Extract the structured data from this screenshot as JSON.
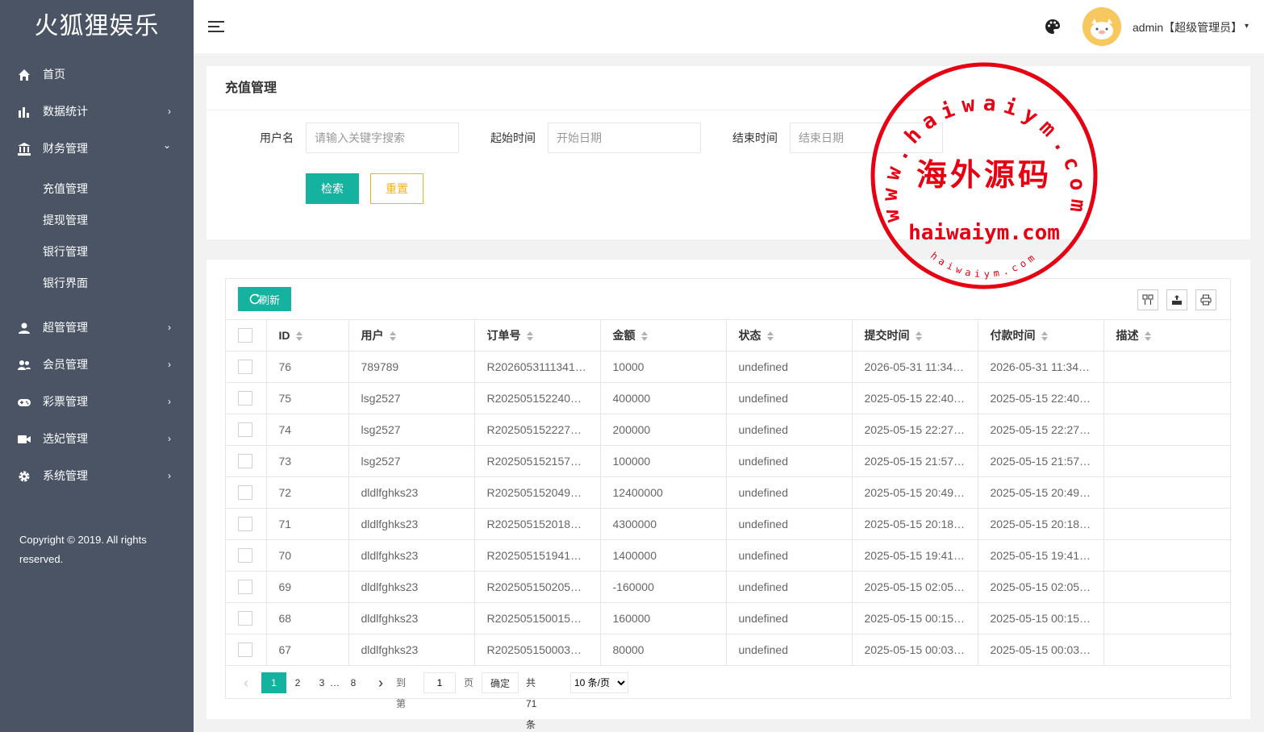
{
  "app": {
    "logo": "火狐狸娱乐",
    "copyright": "Copyright © 2019. All rights reserved."
  },
  "sidebar": {
    "items": [
      {
        "label": "首页",
        "icon": "home-icon"
      },
      {
        "label": "数据统计",
        "icon": "bar-chart-icon",
        "caret": "›"
      },
      {
        "label": "财务管理",
        "icon": "bank-icon",
        "caret": "⌄"
      },
      {
        "label": "超管管理",
        "icon": "user-icon",
        "caret": "›"
      },
      {
        "label": "会员管理",
        "icon": "users-icon",
        "caret": "›"
      },
      {
        "label": "彩票管理",
        "icon": "gamepad-icon",
        "caret": "›"
      },
      {
        "label": "选妃管理",
        "icon": "video-icon",
        "caret": "›"
      },
      {
        "label": "系统管理",
        "icon": "gear-icon",
        "caret": "›"
      }
    ],
    "finance_sub": [
      "充值管理",
      "提现管理",
      "银行管理",
      "银行界面"
    ]
  },
  "header": {
    "user": "admin【超级管理员】",
    "caret": "▾",
    "palette_icon": "palette-icon"
  },
  "search": {
    "title": "充值管理",
    "username_label": "用户名",
    "username_placeholder": "请输入关键字搜索",
    "start_label": "起始时间",
    "start_placeholder": "开始日期",
    "end_label": "结束时间",
    "end_placeholder": "结束日期",
    "search_button": "检索",
    "reset_button": "重置"
  },
  "table": {
    "refresh_button": "刷新",
    "columns": [
      "ID",
      "用户",
      "订单号",
      "金额",
      "状态",
      "提交时间",
      "付款时间",
      "描述"
    ],
    "rows": [
      [
        "76",
        "789789",
        "R2026053111341…",
        "10000",
        "undefined",
        "2026-05-31 11:34…",
        "2026-05-31 11:34…",
        ""
      ],
      [
        "75",
        "lsg2527",
        "R202505152240…",
        "400000",
        "undefined",
        "2025-05-15 22:40…",
        "2025-05-15 22:40…",
        ""
      ],
      [
        "74",
        "lsg2527",
        "R202505152227…",
        "200000",
        "undefined",
        "2025-05-15 22:27…",
        "2025-05-15 22:27…",
        ""
      ],
      [
        "73",
        "lsg2527",
        "R202505152157…",
        "100000",
        "undefined",
        "2025-05-15 21:57…",
        "2025-05-15 21:57…",
        ""
      ],
      [
        "72",
        "dldlfghks23",
        "R202505152049…",
        "12400000",
        "undefined",
        "2025-05-15 20:49…",
        "2025-05-15 20:49…",
        ""
      ],
      [
        "71",
        "dldlfghks23",
        "R202505152018…",
        "4300000",
        "undefined",
        "2025-05-15 20:18…",
        "2025-05-15 20:18…",
        ""
      ],
      [
        "70",
        "dldlfghks23",
        "R202505151941…",
        "1400000",
        "undefined",
        "2025-05-15 19:41…",
        "2025-05-15 19:41…",
        ""
      ],
      [
        "69",
        "dldlfghks23",
        "R202505150205…",
        "-160000",
        "undefined",
        "2025-05-15 02:05…",
        "2025-05-15 02:05…",
        ""
      ],
      [
        "68",
        "dldlfghks23",
        "R202505150015…",
        "160000",
        "undefined",
        "2025-05-15 00:15…",
        "2025-05-15 00:15…",
        ""
      ],
      [
        "67",
        "dldlfghks23",
        "R202505150003…",
        "80000",
        "undefined",
        "2025-05-15 00:03…",
        "2025-05-15 00:03…",
        ""
      ]
    ]
  },
  "pager": {
    "prev": "‹",
    "pages": [
      "1",
      "2",
      "3"
    ],
    "ellipsis": "…",
    "last": "8",
    "next": "›",
    "goto_label": "到第",
    "goto_value": "1",
    "page_unit": "页",
    "confirm": "确定",
    "total": "共 71 条",
    "page_size": "10 条/页"
  },
  "watermark": {
    "outer_text": "www.haiwaiym.com",
    "center_text": "海外源码",
    "domain": "haiwaiym.com",
    "bottom_text": "haiwaiym.com",
    "color": "#e60012"
  },
  "colors": {
    "sidebar": "#4a5465",
    "accent": "#16b2a0",
    "warning": "#f0b31a"
  }
}
